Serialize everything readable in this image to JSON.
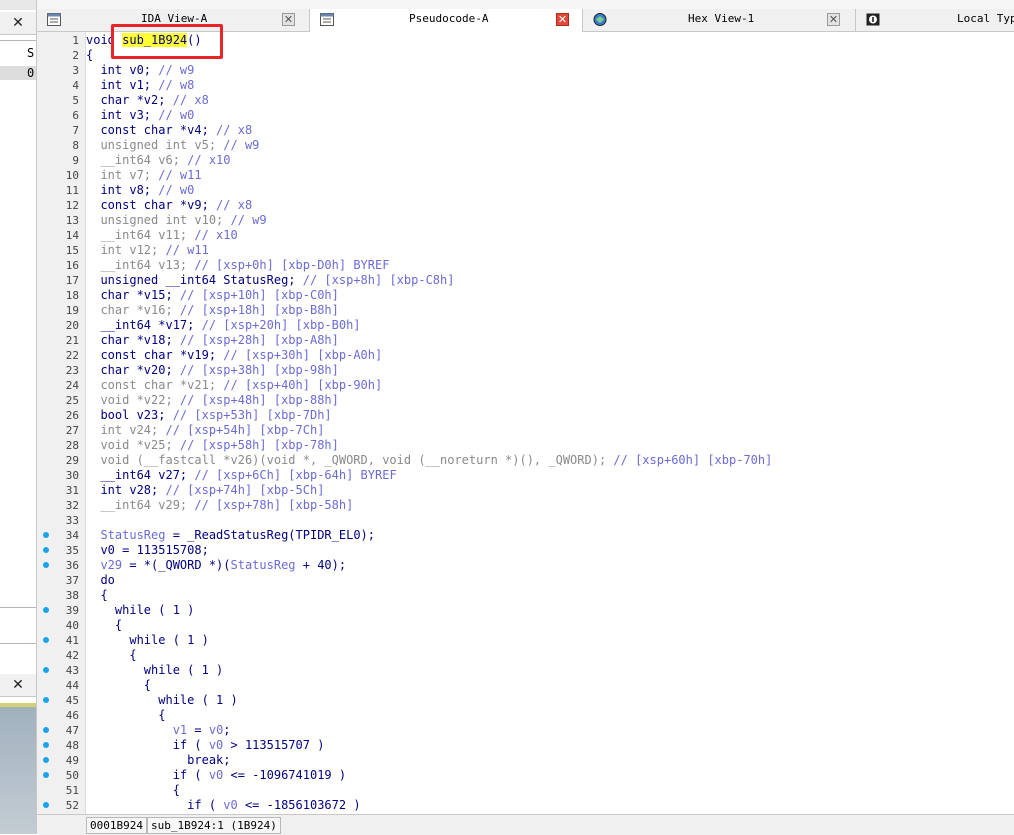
{
  "left_panel": {
    "close_glyph": "✕",
    "text_s": "S",
    "text_0": "0"
  },
  "tabs": [
    {
      "label": "IDA View-A",
      "icon": "ida-view-icon"
    },
    {
      "label": "Pseudocode-A",
      "icon": "pseudocode-icon"
    },
    {
      "label": "Hex View-1",
      "icon": "hex-view-icon"
    },
    {
      "label": "Local Types",
      "icon": "local-types-icon"
    }
  ],
  "close_glyph": "✕",
  "code_lines": [
    {
      "n": "1",
      "dot": false,
      "seg": [
        [
          "",
          "void "
        ],
        [
          "hl",
          "sub_1B924"
        ],
        [
          "",
          "()"
        ]
      ]
    },
    {
      "n": "2",
      "dot": false,
      "seg": [
        [
          "",
          "{"
        ]
      ]
    },
    {
      "n": "3",
      "dot": false,
      "seg": [
        [
          "",
          "  int v0; "
        ],
        [
          "c",
          "// w9"
        ]
      ]
    },
    {
      "n": "4",
      "dot": false,
      "seg": [
        [
          "",
          "  int v1; "
        ],
        [
          "c",
          "// w8"
        ]
      ]
    },
    {
      "n": "5",
      "dot": false,
      "seg": [
        [
          "",
          "  char *v2; "
        ],
        [
          "c",
          "// x8"
        ]
      ]
    },
    {
      "n": "6",
      "dot": false,
      "seg": [
        [
          "",
          "  int v3; "
        ],
        [
          "c",
          "// w0"
        ]
      ]
    },
    {
      "n": "7",
      "dot": false,
      "seg": [
        [
          "",
          "  const char *v4; "
        ],
        [
          "c",
          "// x8"
        ]
      ]
    },
    {
      "n": "8",
      "dot": false,
      "seg": [
        [
          "g",
          "  unsigned int v5; "
        ],
        [
          "c",
          "// w9"
        ]
      ]
    },
    {
      "n": "9",
      "dot": false,
      "seg": [
        [
          "g",
          "  __int64 v6; "
        ],
        [
          "c",
          "// x10"
        ]
      ]
    },
    {
      "n": "10",
      "dot": false,
      "seg": [
        [
          "g",
          "  int v7; "
        ],
        [
          "c",
          "// w11"
        ]
      ]
    },
    {
      "n": "11",
      "dot": false,
      "seg": [
        [
          "",
          "  int v8; "
        ],
        [
          "c",
          "// w0"
        ]
      ]
    },
    {
      "n": "12",
      "dot": false,
      "seg": [
        [
          "",
          "  const char *v9; "
        ],
        [
          "c",
          "// x8"
        ]
      ]
    },
    {
      "n": "13",
      "dot": false,
      "seg": [
        [
          "g",
          "  unsigned int v10; "
        ],
        [
          "c",
          "// w9"
        ]
      ]
    },
    {
      "n": "14",
      "dot": false,
      "seg": [
        [
          "g",
          "  __int64 v11; "
        ],
        [
          "c",
          "// x10"
        ]
      ]
    },
    {
      "n": "15",
      "dot": false,
      "seg": [
        [
          "g",
          "  int v12; "
        ],
        [
          "c",
          "// w11"
        ]
      ]
    },
    {
      "n": "16",
      "dot": false,
      "seg": [
        [
          "g",
          "  __int64 v13; "
        ],
        [
          "c",
          "// [xsp+0h] [xbp-D0h] BYREF"
        ]
      ]
    },
    {
      "n": "17",
      "dot": false,
      "seg": [
        [
          "",
          "  unsigned __int64 StatusReg; "
        ],
        [
          "c",
          "// [xsp+8h] [xbp-C8h]"
        ]
      ]
    },
    {
      "n": "18",
      "dot": false,
      "seg": [
        [
          "",
          "  char *v15; "
        ],
        [
          "c",
          "// [xsp+10h] [xbp-C0h]"
        ]
      ]
    },
    {
      "n": "19",
      "dot": false,
      "seg": [
        [
          "g",
          "  char *v16; "
        ],
        [
          "c",
          "// [xsp+18h] [xbp-B8h]"
        ]
      ]
    },
    {
      "n": "20",
      "dot": false,
      "seg": [
        [
          "",
          "  __int64 *v17; "
        ],
        [
          "c",
          "// [xsp+20h] [xbp-B0h]"
        ]
      ]
    },
    {
      "n": "21",
      "dot": false,
      "seg": [
        [
          "",
          "  char *v18; "
        ],
        [
          "c",
          "// [xsp+28h] [xbp-A8h]"
        ]
      ]
    },
    {
      "n": "22",
      "dot": false,
      "seg": [
        [
          "",
          "  const char *v19; "
        ],
        [
          "c",
          "// [xsp+30h] [xbp-A0h]"
        ]
      ]
    },
    {
      "n": "23",
      "dot": false,
      "seg": [
        [
          "",
          "  char *v20; "
        ],
        [
          "c",
          "// [xsp+38h] [xbp-98h]"
        ]
      ]
    },
    {
      "n": "24",
      "dot": false,
      "seg": [
        [
          "g",
          "  const char *v21; "
        ],
        [
          "c",
          "// [xsp+40h] [xbp-90h]"
        ]
      ]
    },
    {
      "n": "25",
      "dot": false,
      "seg": [
        [
          "g",
          "  void *v22; "
        ],
        [
          "c",
          "// [xsp+48h] [xbp-88h]"
        ]
      ]
    },
    {
      "n": "26",
      "dot": false,
      "seg": [
        [
          "",
          "  bool v23; "
        ],
        [
          "c",
          "// [xsp+53h] [xbp-7Dh]"
        ]
      ]
    },
    {
      "n": "27",
      "dot": false,
      "seg": [
        [
          "g",
          "  int v24; "
        ],
        [
          "c",
          "// [xsp+54h] [xbp-7Ch]"
        ]
      ]
    },
    {
      "n": "28",
      "dot": false,
      "seg": [
        [
          "g",
          "  void *v25; "
        ],
        [
          "c",
          "// [xsp+58h] [xbp-78h]"
        ]
      ]
    },
    {
      "n": "29",
      "dot": false,
      "seg": [
        [
          "g",
          "  void (__fastcall *v26)(void *, _QWORD, void (__noreturn *)(), _QWORD); "
        ],
        [
          "c",
          "// [xsp+60h] [xbp-70h]"
        ]
      ]
    },
    {
      "n": "30",
      "dot": false,
      "seg": [
        [
          "",
          "  __int64 v27; "
        ],
        [
          "c",
          "// [xsp+6Ch] [xbp-64h] BYREF"
        ]
      ]
    },
    {
      "n": "31",
      "dot": false,
      "seg": [
        [
          "",
          "  int v28; "
        ],
        [
          "c",
          "// [xsp+74h] [xbp-5Ch]"
        ]
      ]
    },
    {
      "n": "32",
      "dot": false,
      "seg": [
        [
          "g",
          "  __int64 v29; "
        ],
        [
          "c",
          "// [xsp+78h] [xbp-58h]"
        ]
      ]
    },
    {
      "n": "33",
      "dot": false,
      "seg": [
        [
          "",
          ""
        ]
      ]
    },
    {
      "n": "34",
      "dot": true,
      "seg": [
        [
          "c",
          "  StatusReg"
        ],
        [
          "",
          " = _ReadStatusReg(TPIDR_EL0);"
        ]
      ]
    },
    {
      "n": "35",
      "dot": true,
      "seg": [
        [
          "",
          "  v0 = 113515708;"
        ]
      ]
    },
    {
      "n": "36",
      "dot": true,
      "seg": [
        [
          "c",
          "  v29"
        ],
        [
          "",
          " = *(_QWORD *)("
        ],
        [
          "c",
          "StatusReg"
        ],
        [
          "",
          " + 40);"
        ]
      ]
    },
    {
      "n": "37",
      "dot": false,
      "seg": [
        [
          "",
          "  do"
        ]
      ]
    },
    {
      "n": "38",
      "dot": false,
      "seg": [
        [
          "",
          "  {"
        ]
      ]
    },
    {
      "n": "39",
      "dot": true,
      "seg": [
        [
          "",
          "    while ( 1 )"
        ]
      ]
    },
    {
      "n": "40",
      "dot": false,
      "seg": [
        [
          "",
          "    {"
        ]
      ]
    },
    {
      "n": "41",
      "dot": true,
      "seg": [
        [
          "",
          "      while ( 1 )"
        ]
      ]
    },
    {
      "n": "42",
      "dot": false,
      "seg": [
        [
          "",
          "      {"
        ]
      ]
    },
    {
      "n": "43",
      "dot": true,
      "seg": [
        [
          "",
          "        while ( 1 )"
        ]
      ]
    },
    {
      "n": "44",
      "dot": false,
      "seg": [
        [
          "",
          "        {"
        ]
      ]
    },
    {
      "n": "45",
      "dot": true,
      "seg": [
        [
          "",
          "          while ( 1 )"
        ]
      ]
    },
    {
      "n": "46",
      "dot": false,
      "seg": [
        [
          "",
          "          {"
        ]
      ]
    },
    {
      "n": "47",
      "dot": true,
      "seg": [
        [
          "c",
          "            v1"
        ],
        [
          "",
          " = "
        ],
        [
          "c",
          "v0"
        ],
        [
          "",
          ";"
        ]
      ]
    },
    {
      "n": "48",
      "dot": true,
      "seg": [
        [
          "",
          "            if ( "
        ],
        [
          "c",
          "v0"
        ],
        [
          "",
          " > 113515707 )"
        ]
      ]
    },
    {
      "n": "49",
      "dot": true,
      "seg": [
        [
          "",
          "              break;"
        ]
      ]
    },
    {
      "n": "50",
      "dot": true,
      "seg": [
        [
          "",
          "            if ( "
        ],
        [
          "c",
          "v0"
        ],
        [
          "",
          " <= -1096741019 )"
        ]
      ]
    },
    {
      "n": "51",
      "dot": false,
      "seg": [
        [
          "",
          "            {"
        ]
      ]
    },
    {
      "n": "52",
      "dot": true,
      "seg": [
        [
          "",
          "              if ( "
        ],
        [
          "c",
          "v0"
        ],
        [
          "",
          " <= -1856103672 )"
        ]
      ]
    }
  ],
  "status": {
    "address": "0001B924",
    "location": "sub_1B924:1 (1B924)"
  }
}
